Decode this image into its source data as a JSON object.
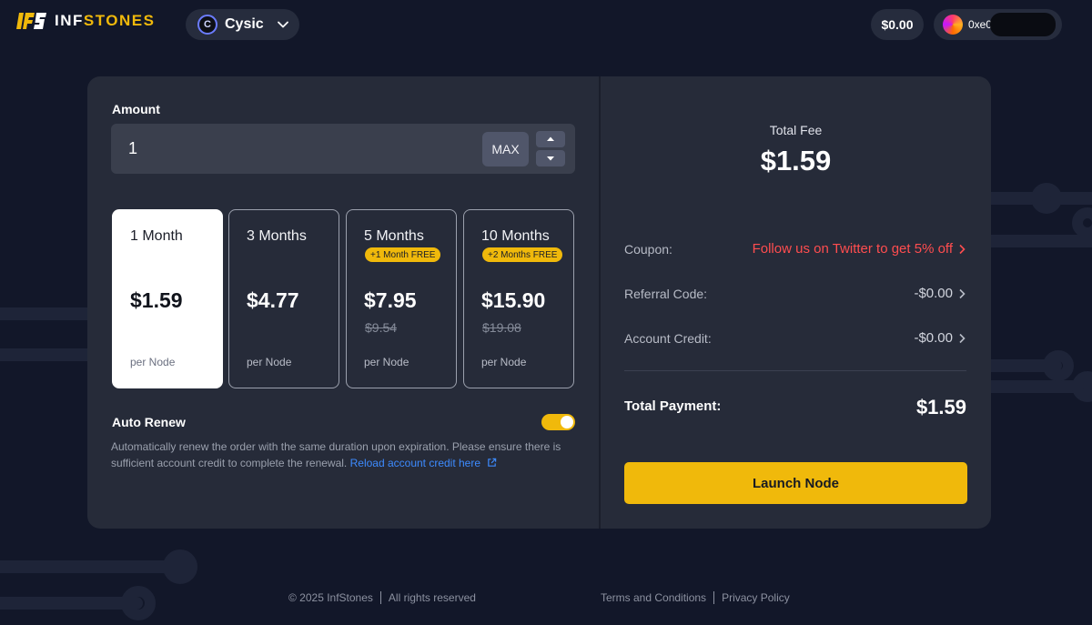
{
  "header": {
    "logo_text_main": "INF",
    "logo_text_accent": "STONES",
    "logo_mark_text": "IFS",
    "network_name": "Cysic",
    "network_icon_glyph": "C",
    "balance": "$0.00",
    "wallet_address": "0xe0",
    "network_icon": "cysic-logo-icon",
    "dropdown_icon": "chevron-down-icon"
  },
  "left": {
    "amount_label": "Amount",
    "amount_value": "1",
    "max_label": "MAX",
    "plans": [
      {
        "title": "1 Month",
        "price": "$1.59",
        "old_price": "",
        "badge": "",
        "unit": "per Node",
        "selected": true
      },
      {
        "title": "3 Months",
        "price": "$4.77",
        "old_price": "",
        "badge": "",
        "unit": "per Node",
        "selected": false
      },
      {
        "title": "5 Months",
        "price": "$7.95",
        "old_price": "$9.54",
        "badge": "+1 Month FREE",
        "unit": "per Node",
        "selected": false
      },
      {
        "title": "10 Months",
        "price": "$15.90",
        "old_price": "$19.08",
        "badge": "+2 Months FREE",
        "unit": "per Node",
        "selected": false
      }
    ],
    "auto_renew_label": "Auto Renew",
    "auto_renew_on": true,
    "auto_renew_desc": "Automatically renew the order with the same duration upon expiration. Please ensure there is sufficient account credit to complete the renewal.",
    "reload_link": "Reload account credit here"
  },
  "right": {
    "total_fee_label": "Total Fee",
    "total_fee_value": "$1.59",
    "coupon_label": "Coupon:",
    "coupon_value": "Follow us on Twitter to get 5% off",
    "referral_label": "Referral Code:",
    "referral_value": "-$0.00",
    "credit_label": "Account Credit:",
    "credit_value": "-$0.00",
    "total_payment_label": "Total Payment:",
    "total_payment_value": "$1.59",
    "launch_label": "Launch Node"
  },
  "footer": {
    "copyright": "© 2025 InfStones",
    "rights": "All rights reserved",
    "terms": "Terms and Conditions",
    "privacy": "Privacy Policy"
  },
  "colors": {
    "background": "#121729",
    "card": "#262b39",
    "accent": "#f0b90b",
    "coupon": "#ff4d4f",
    "link": "#3d8bff"
  }
}
